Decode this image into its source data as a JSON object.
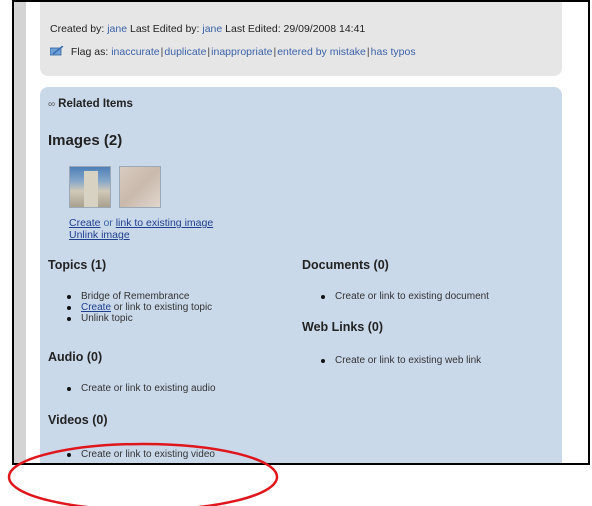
{
  "meta": {
    "created_by_label": "Created by:",
    "created_by": "jane",
    "last_edited_by_label": "Last Edited by:",
    "last_edited_by": "jane",
    "last_edited_label": "Last Edited:",
    "last_edited": "29/09/2008 14:41"
  },
  "flag": {
    "label": "Flag as:",
    "options": [
      "inaccurate",
      "duplicate",
      "inappropriate",
      "entered by mistake",
      "has typos"
    ]
  },
  "related": {
    "title": "Related Items",
    "images": {
      "heading": "Images (2)",
      "create": "Create",
      "or": "or",
      "link_existing": "link to existing image",
      "unlink": "Unlink image"
    },
    "topics": {
      "heading": "Topics (1)",
      "items": [
        "Bridge of Remembrance"
      ],
      "create": "Create",
      "link_existing_rest": " or link to existing topic",
      "unlink": "Unlink topic"
    },
    "audio": {
      "heading": "Audio (0)",
      "item": "Create or link to existing audio"
    },
    "videos": {
      "heading": "Videos (0)",
      "item": "Create or link to existing video"
    },
    "documents": {
      "heading": "Documents (0)",
      "item": "Create or link to existing document"
    },
    "web_links": {
      "heading": "Web Links (0)",
      "item": "Create or link to existing web link"
    }
  },
  "colors": {
    "panel_blue": "#cad9ea",
    "meta_gray": "#e6e6e6",
    "link_blue": "#3b62a8",
    "annotation_red": "#e0161d"
  }
}
